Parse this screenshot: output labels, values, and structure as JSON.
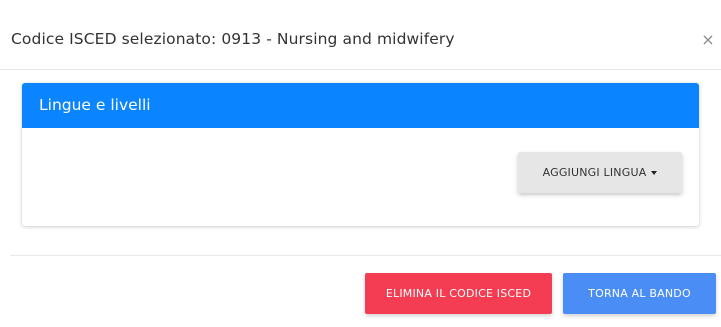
{
  "modal": {
    "title": "Codice ISCED selezionato: 0913 - Nursing and midwifery",
    "close_symbol": "×"
  },
  "card": {
    "title": "Lingue e livelli",
    "add_language_label": "AGGIUNGI LINGUA",
    "add_language_icon": "caret-down-icon"
  },
  "footer": {
    "delete_label": "ELIMINA IL CODICE ISCED",
    "back_label": "TORNA AL BANDO"
  },
  "colors": {
    "card_header": "#0a84ff",
    "delete_button": "#f43d52",
    "back_button": "#4a8ef5",
    "add_language_button": "#e6e6e6"
  }
}
